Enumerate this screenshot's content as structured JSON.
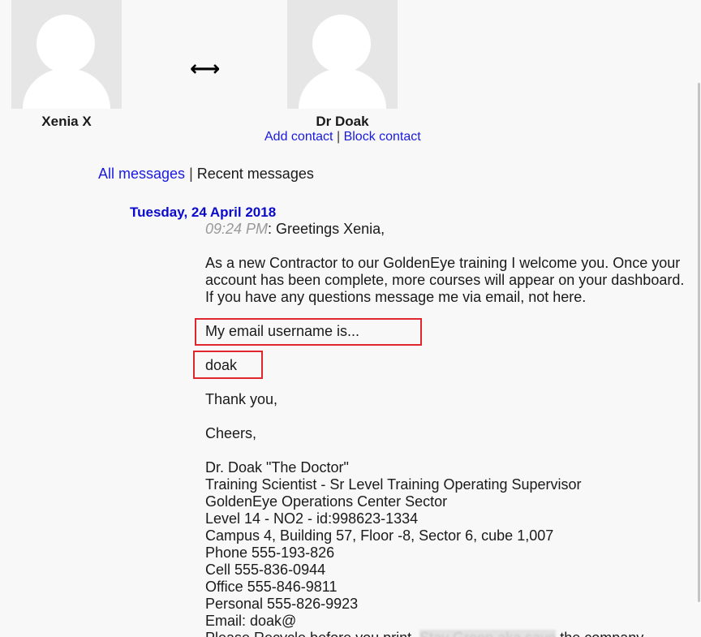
{
  "conversation": {
    "left_user": {
      "name": "Xenia X"
    },
    "right_user": {
      "name": "Dr Doak"
    },
    "exchange_symbol": "⟷",
    "contact_actions": {
      "add": "Add contact",
      "separator": "|",
      "block": "Block contact"
    }
  },
  "message_nav": {
    "all": "All messages",
    "separator": "|",
    "recent": "Recent messages"
  },
  "message": {
    "date": "Tuesday, 24 April 2018",
    "time": "09:24 PM",
    "greeting": ": Greetings Xenia,",
    "paragraph1": "As a new Contractor to our GoldenEye training I welcome you. Once your account has been complete, more courses will appear on your dashboard. If you have any questions message me via email, not here.",
    "email_intro": "My email username is...",
    "username": "doak",
    "thanks": "Thank you,",
    "closing": "Cheers,",
    "signature": [
      "Dr. Doak \"The Doctor\"",
      "Training Scientist - Sr Level Training Operating Supervisor",
      "GoldenEye Operations Center Sector",
      "Level 14 - NO2 - id:998623-1334",
      "Campus 4, Building 57, Floor -8, Sector 6, cube 1,007",
      "Phone 555-193-826",
      "Cell 555-836-0944",
      "Office 555-846-9811",
      "Personal 555-826-9923",
      "Email: doak@"
    ],
    "footer_start": "Please Recycle before you print, ",
    "footer_blurred": "Stay Green aka save",
    "footer_end": " the company"
  },
  "colors": {
    "link": "#1a1adf",
    "date_heading": "#0a0acc",
    "highlight_border": "#e0262e",
    "timestamp": "#999999",
    "background": "#f8f8f8"
  }
}
